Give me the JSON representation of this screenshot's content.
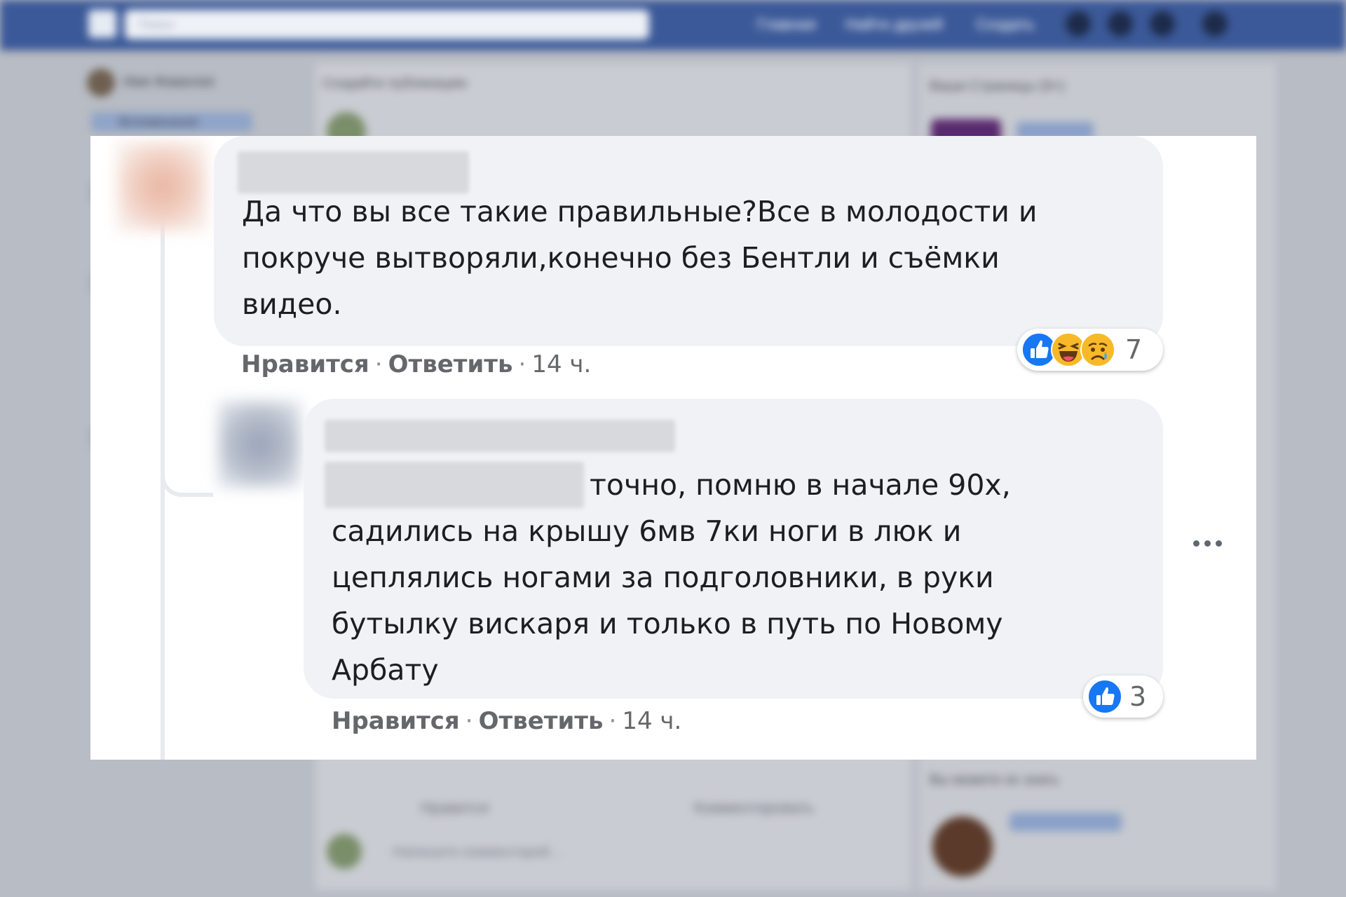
{
  "background": {
    "search_placeholder": "Поиск",
    "nav": [
      "Главная",
      "Найти друзей",
      "Создать"
    ],
    "left_user": "Имя Фамилия",
    "left_items": [
      "Вспоминания"
    ],
    "feed_header": "Создайте публикацию",
    "right_header": "Ваши Страницы (9+)",
    "right_footer": "Вы можете их знать",
    "feed_actions": [
      "Нравится",
      "Комментировать"
    ],
    "comment_placeholder": "Напишите комментарий..."
  },
  "comments": [
    {
      "author": "",
      "text": "Да что вы все такие правильные?Все в молодости и\nпокруче вытворяли,конечно без Бентли и съёмки\nвидео.",
      "actions": {
        "like": "Нравится",
        "reply": "Ответить",
        "time": "14 ч."
      },
      "reactions": {
        "icons": [
          "like-icon",
          "haha-icon",
          "sad-icon"
        ],
        "count": "7"
      }
    },
    {
      "author": "",
      "mention": "",
      "text_first_line": "точно, помню в начале 90х,",
      "text": "садились на крышу 6мв 7ки ноги в люк и\nцеплялись ногами за подголовники, в руки\nбутылку вискаря и только в путь по Новому\nАрбату",
      "actions": {
        "like": "Нравится",
        "reply": "Ответить",
        "time": "14 ч."
      },
      "reactions": {
        "icons": [
          "like-icon"
        ],
        "count": "3"
      }
    }
  ],
  "colors": {
    "bubble": "#f0f2f5",
    "like": "#1877f2",
    "haha": "#f7b928",
    "action_text": "#65676b",
    "facebook_blue": "#3b5998"
  }
}
